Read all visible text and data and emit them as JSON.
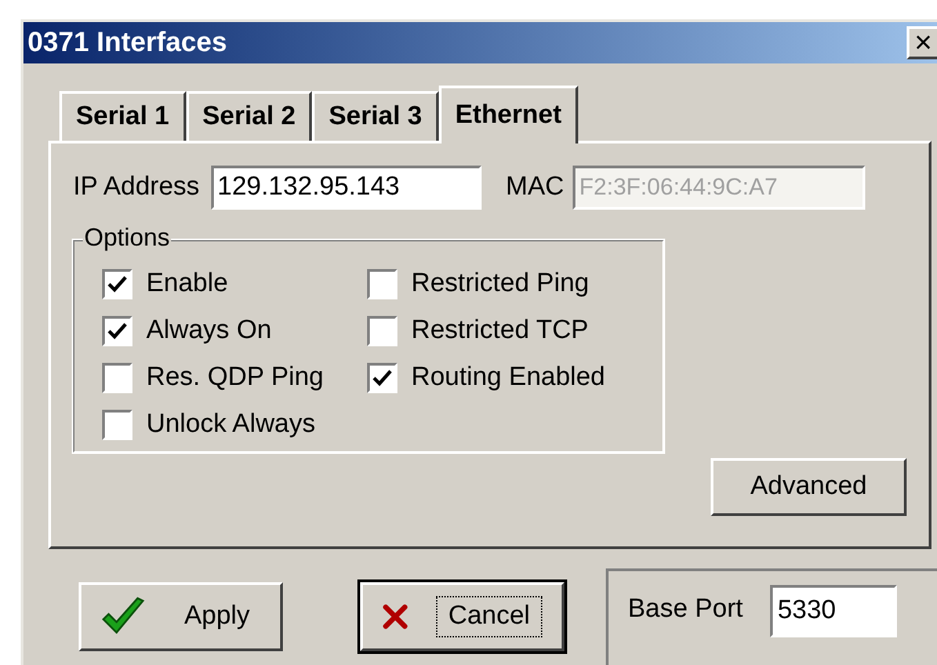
{
  "window": {
    "title": "0371 Interfaces",
    "close": "×"
  },
  "tabs": [
    {
      "label": "Serial 1",
      "selected": false
    },
    {
      "label": "Serial 2",
      "selected": false
    },
    {
      "label": "Serial 3",
      "selected": false
    },
    {
      "label": "Ethernet",
      "selected": true
    }
  ],
  "ip_address": {
    "label": "IP Address",
    "value": "129.132.95.143"
  },
  "mac": {
    "label": "MAC",
    "value": "F2:3F:06:44:9C:A7",
    "disabled": true
  },
  "options": {
    "title": "Options",
    "columns": [
      [
        {
          "label": "Enable",
          "checked": true
        },
        {
          "label": "Always On",
          "checked": true
        },
        {
          "label": "Res. QDP Ping",
          "checked": false
        },
        {
          "label": "Unlock Always",
          "checked": false
        }
      ],
      [
        {
          "label": "Restricted Ping",
          "checked": false
        },
        {
          "label": "Restricted TCP",
          "checked": false
        },
        {
          "label": "Routing Enabled",
          "checked": true
        }
      ]
    ]
  },
  "advanced_button": "Advanced",
  "buttons": [
    {
      "kind": "apply",
      "label": "Apply",
      "focused": false
    },
    {
      "kind": "cancel",
      "label": "Cancel",
      "focused": true
    }
  ],
  "base_port": {
    "label": "Base Port",
    "value": "5330"
  }
}
